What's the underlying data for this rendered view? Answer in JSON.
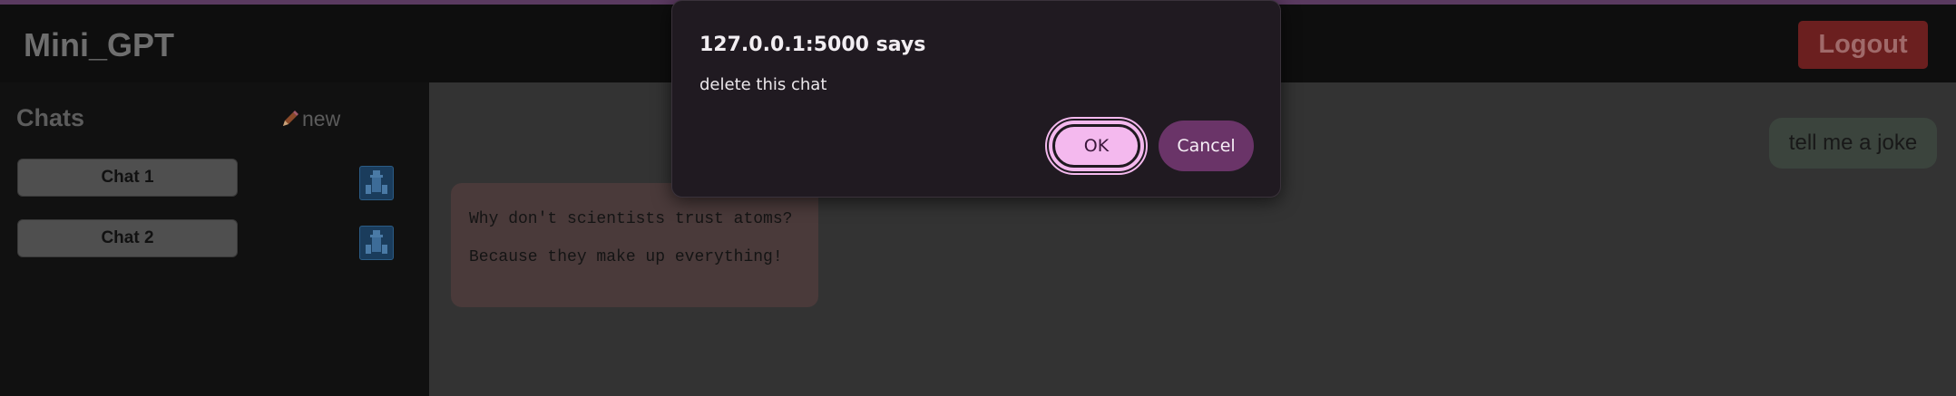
{
  "header": {
    "brand": "Mini_GPT",
    "logout_label": "Logout"
  },
  "sidebar": {
    "heading": "Chats",
    "new_label": "new",
    "chats": [
      {
        "label": "Chat 1"
      },
      {
        "label": "Chat 2"
      }
    ]
  },
  "conversation": {
    "user_message": "tell me a joke",
    "bot_lines": [
      "Why don't scientists trust atoms?",
      "Because they make up everything!"
    ]
  },
  "dialog": {
    "title": "127.0.0.1:5000 says",
    "message": "delete this chat",
    "ok_label": "OK",
    "cancel_label": "Cancel"
  },
  "icons": {
    "new": "pencil-icon",
    "delete": "trash-icon"
  },
  "colors": {
    "logout_bg": "#6b1f1f",
    "ok_bg": "#f4b9ee",
    "cancel_bg": "#6a3468"
  }
}
